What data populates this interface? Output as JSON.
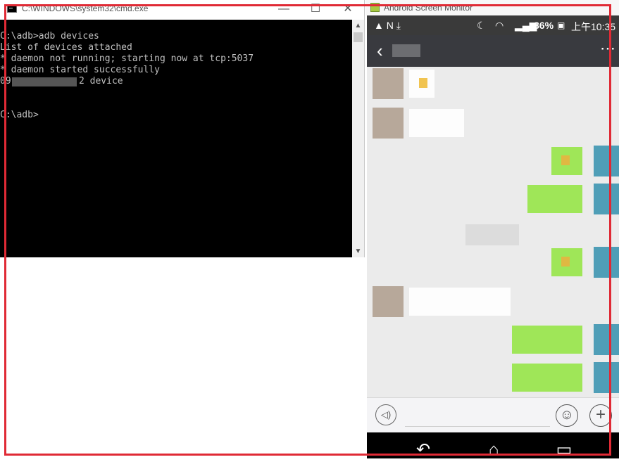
{
  "cmd": {
    "title": "C:\\WINDOWS\\system32\\cmd.exe",
    "controls": {
      "minimize": "—",
      "maximize": "☐",
      "close": "✕"
    },
    "lines": [
      "C:\\adb>adb devices",
      "List of devices attached",
      "* daemon not running; starting now at tcp:5037",
      "* daemon started successfully",
      "09",
      "2 device",
      "C:\\adb>"
    ],
    "scroll": {
      "up": "▲",
      "down": "▼"
    }
  },
  "android": {
    "title": "Android Screen Monitor",
    "status": {
      "left_icons": "▲ N ⤓",
      "battery": "86%",
      "time": "上午10:35"
    },
    "chat": {
      "back": "‹",
      "more": "⋯"
    },
    "input": {
      "voice": "◁)",
      "emoji": "☺",
      "plus": "+"
    },
    "nav": {
      "back": "↶",
      "home": "⌂",
      "recent": "▭"
    }
  },
  "colors": {
    "highlight": "#e02a35",
    "bubble_self": "#9fe658",
    "chat_bg": "#ebebeb"
  }
}
